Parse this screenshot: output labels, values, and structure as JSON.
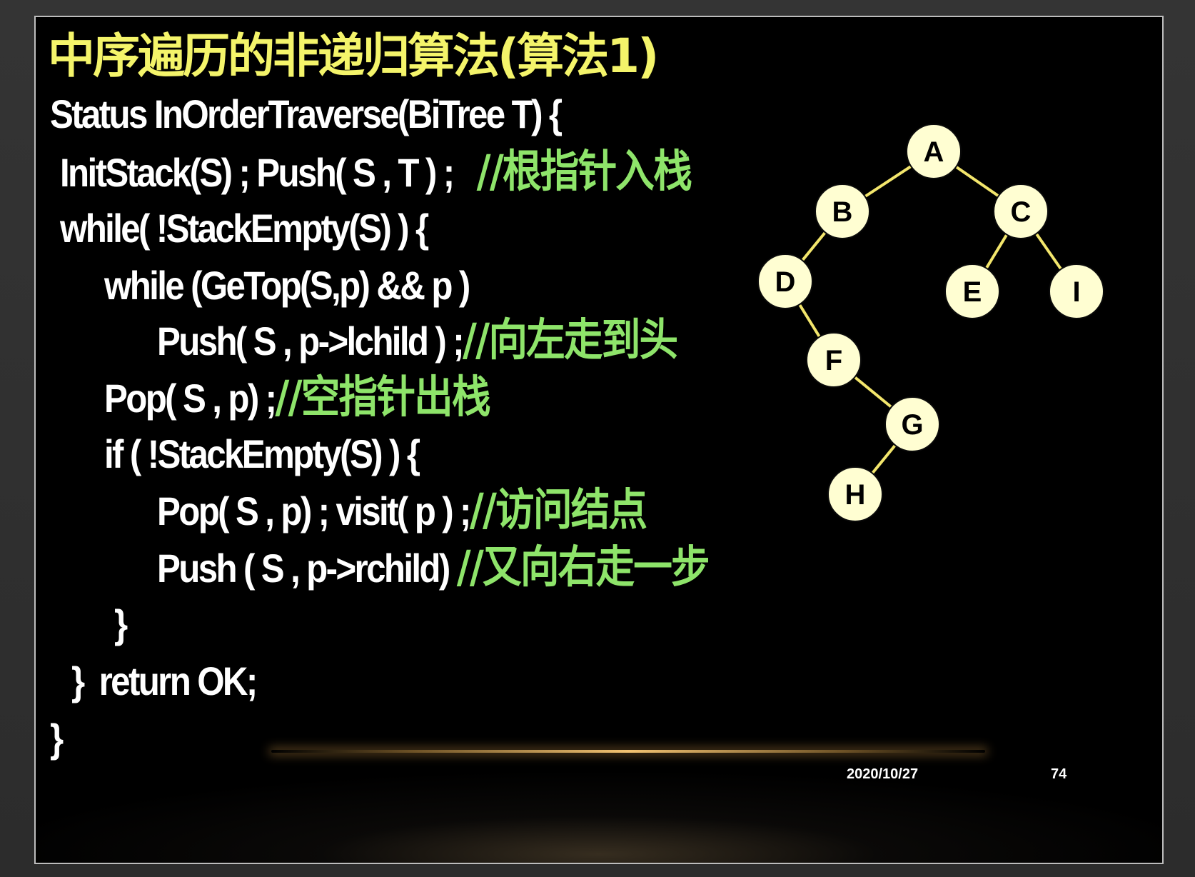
{
  "slide": {
    "title": "中序遍历的非递归算法(算法1)",
    "code": [
      {
        "code": "Status InOrderTraverse(BiTree T) {",
        "comment": ""
      },
      {
        "code": "InitStack(S) ; Push( S , T ) ;   ",
        "comment": "//根指针入栈"
      },
      {
        "code": "while( !StackEmpty(S) ) {",
        "comment": ""
      },
      {
        "code": "while (GeTop(S,p) && p )",
        "comment": ""
      },
      {
        "code": "Push( S , p->lchild ) ;",
        "comment": "//向左走到头"
      },
      {
        "code": "Pop( S , p) ;",
        "comment": "//空指针出栈"
      },
      {
        "code": "if ( !StackEmpty(S) ) {",
        "comment": ""
      },
      {
        "code": "Pop( S , p) ; visit( p ) ;",
        "comment": "//访问结点"
      },
      {
        "code": "Push ( S , p->rchild) ",
        "comment": "//又向右走一步"
      },
      {
        "code": "}",
        "comment": ""
      },
      {
        "code": "}  return OK;",
        "comment": ""
      },
      {
        "code": "}",
        "comment": ""
      }
    ],
    "tree": {
      "nodes": [
        "A",
        "B",
        "C",
        "D",
        "E",
        "I",
        "F",
        "G",
        "H"
      ],
      "edges": [
        [
          "A",
          "B"
        ],
        [
          "A",
          "C"
        ],
        [
          "B",
          "D"
        ],
        [
          "C",
          "E"
        ],
        [
          "C",
          "I"
        ],
        [
          "D",
          "F"
        ],
        [
          "F",
          "G"
        ],
        [
          "G",
          "H"
        ]
      ]
    },
    "footer": {
      "date": "2020/10/27",
      "page": "74"
    },
    "colors": {
      "title": "#f4f46a",
      "code": "#ffffff",
      "comment": "#8ee46a",
      "node_fill": "#fffed2",
      "edge": "#f3e66c",
      "background": "#000000"
    }
  }
}
